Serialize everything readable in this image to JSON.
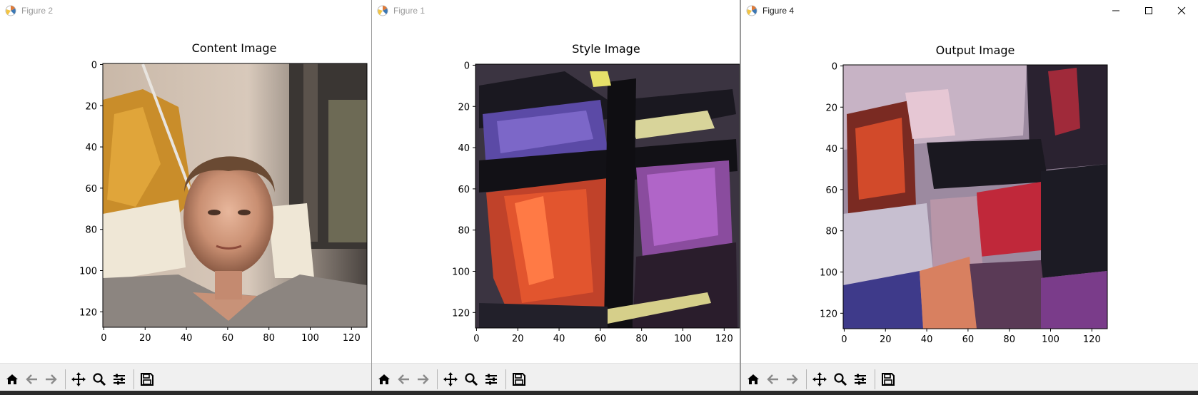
{
  "windows": [
    {
      "key": "fig2",
      "title": "Figure 2",
      "active": false,
      "axes_title": "Content Image",
      "image_desc": "content"
    },
    {
      "key": "fig1",
      "title": "Figure 1",
      "active": false,
      "axes_title": "Style Image",
      "image_desc": "style"
    },
    {
      "key": "fig4",
      "title": "Figure 4",
      "active": true,
      "axes_title": "Output Image",
      "image_desc": "output"
    }
  ],
  "axis": {
    "xticks": [
      "0",
      "20",
      "40",
      "60",
      "80",
      "100",
      "120"
    ],
    "yticks": [
      "0",
      "20",
      "40",
      "60",
      "80",
      "100",
      "120"
    ],
    "xlim": [
      -0.5,
      127.5
    ],
    "ylim": [
      127.5,
      -0.5
    ]
  },
  "toolbar": {
    "buttons": [
      "home-icon",
      "back-icon",
      "forward-icon",
      "pan-icon",
      "zoom-icon",
      "configure-subplots-icon",
      "save-icon"
    ]
  },
  "caption_buttons": [
    "minimize-icon",
    "maximize-icon",
    "close-icon"
  ],
  "colors": {
    "figure_bg": "#ffffff",
    "toolbar_bg": "#f0f0f0",
    "inactive_title": "#9a9a9a",
    "active_title": "#1a1a1a"
  }
}
